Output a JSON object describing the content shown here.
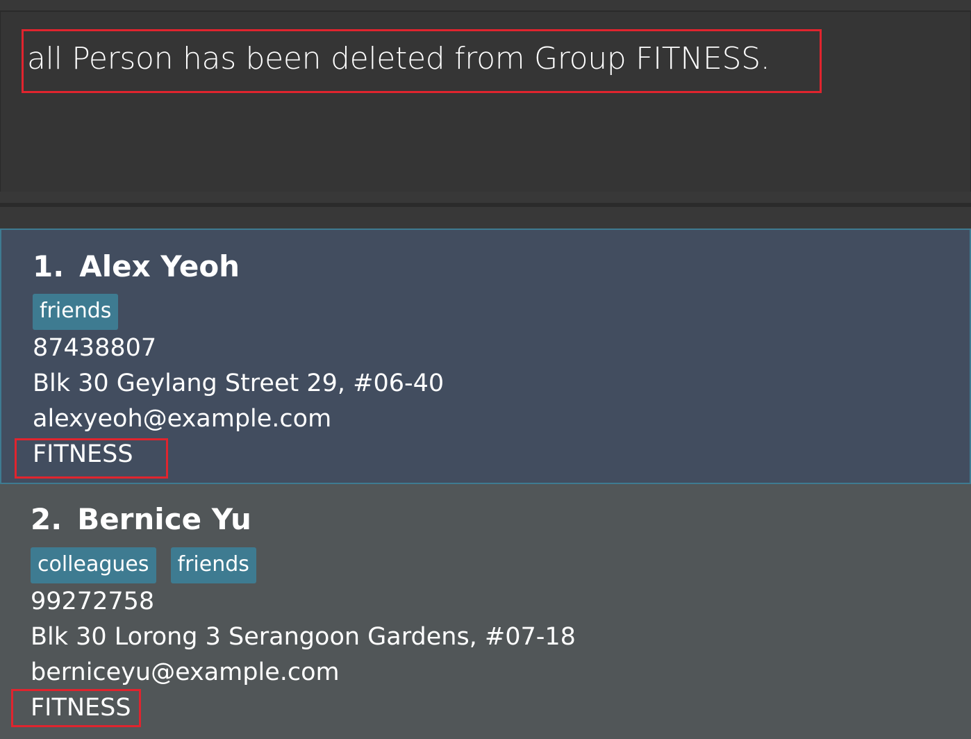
{
  "result_display": {
    "message": "all Person has been deleted from Group FITNESS."
  },
  "person_list": [
    {
      "index": "1.",
      "name": "Alex Yeoh",
      "tags": [
        "friends"
      ],
      "phone": "87438807",
      "address": "Blk 30 Geylang Street 29, #06-40",
      "email": "alexyeoh@example.com",
      "group": "FITNESS",
      "selected": true
    },
    {
      "index": "2.",
      "name": "Bernice Yu",
      "tags": [
        "colleagues",
        "friends"
      ],
      "phone": "99272758",
      "address": "Blk 30 Lorong 3 Serangoon Gardens, #07-18",
      "email": "berniceyu@example.com",
      "group": "FITNESS",
      "selected": false
    }
  ],
  "colors": {
    "background": "#383838",
    "result_box": "#353535",
    "card_selected": "#424d5f",
    "card_normal": "#515658",
    "tag": "#3e7b91",
    "highlight": "#e0242e"
  }
}
